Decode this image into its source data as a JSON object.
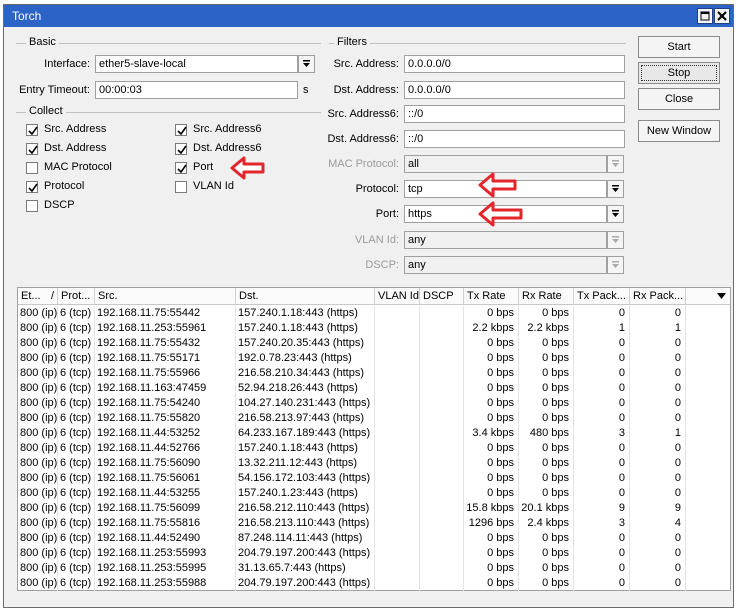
{
  "window": {
    "title": "Torch"
  },
  "basic": {
    "label": "Basic",
    "interface_label": "Interface:",
    "interface_value": "ether5-slave-local",
    "timeout_label": "Entry Timeout:",
    "timeout_value": "00:00:03",
    "timeout_unit": "s"
  },
  "collect": {
    "label": "Collect",
    "items": [
      {
        "label": "Src. Address",
        "checked": true
      },
      {
        "label": "Dst. Address",
        "checked": true
      },
      {
        "label": "MAC Protocol",
        "checked": false
      },
      {
        "label": "Protocol",
        "checked": true
      },
      {
        "label": "DSCP",
        "checked": false
      },
      {
        "label": "Src. Address6",
        "checked": true
      },
      {
        "label": "Dst. Address6",
        "checked": true
      },
      {
        "label": "Port",
        "checked": true
      },
      {
        "label": "VLAN Id",
        "checked": false
      }
    ]
  },
  "filters": {
    "label": "Filters",
    "src_address_label": "Src. Address:",
    "src_address_value": "0.0.0.0/0",
    "dst_address_label": "Dst. Address:",
    "dst_address_value": "0.0.0.0/0",
    "src_address6_label": "Src. Address6:",
    "src_address6_value": "::/0",
    "dst_address6_label": "Dst. Address6:",
    "dst_address6_value": "::/0",
    "mac_protocol_label": "MAC Protocol:",
    "mac_protocol_value": "all",
    "protocol_label": "Protocol:",
    "protocol_value": "tcp",
    "port_label": "Port:",
    "port_value": "https",
    "vlan_label": "VLAN Id:",
    "vlan_value": "any",
    "dscp_label": "DSCP:",
    "dscp_value": "any"
  },
  "buttons": {
    "start": "Start",
    "stop": "Stop",
    "close": "Close",
    "new_window": "New Window"
  },
  "table": {
    "columns": [
      "Et...",
      "Prot...",
      "Src.",
      "Dst.",
      "VLAN Id",
      "DSCP",
      "Tx Rate",
      "Rx Rate",
      "Tx Pack...",
      "Rx Pack..."
    ],
    "sort_indicator": "/",
    "rows": [
      [
        "800 (ip)",
        "6 (tcp)",
        "192.168.11.75:55442",
        "157.240.1.18:443 (https)",
        "",
        "",
        "0 bps",
        "0 bps",
        "0",
        "0"
      ],
      [
        "800 (ip)",
        "6 (tcp)",
        "192.168.11.253:55961",
        "157.240.1.18:443 (https)",
        "",
        "",
        "2.2 kbps",
        "2.2 kbps",
        "1",
        "1"
      ],
      [
        "800 (ip)",
        "6 (tcp)",
        "192.168.11.75:55432",
        "157.240.20.35:443 (https)",
        "",
        "",
        "0 bps",
        "0 bps",
        "0",
        "0"
      ],
      [
        "800 (ip)",
        "6 (tcp)",
        "192.168.11.75:55171",
        "192.0.78.23:443 (https)",
        "",
        "",
        "0 bps",
        "0 bps",
        "0",
        "0"
      ],
      [
        "800 (ip)",
        "6 (tcp)",
        "192.168.11.75:55966",
        "216.58.210.34:443 (https)",
        "",
        "",
        "0 bps",
        "0 bps",
        "0",
        "0"
      ],
      [
        "800 (ip)",
        "6 (tcp)",
        "192.168.11.163:47459",
        "52.94.218.26:443 (https)",
        "",
        "",
        "0 bps",
        "0 bps",
        "0",
        "0"
      ],
      [
        "800 (ip)",
        "6 (tcp)",
        "192.168.11.75:54240",
        "104.27.140.231:443 (https)",
        "",
        "",
        "0 bps",
        "0 bps",
        "0",
        "0"
      ],
      [
        "800 (ip)",
        "6 (tcp)",
        "192.168.11.75:55820",
        "216.58.213.97:443 (https)",
        "",
        "",
        "0 bps",
        "0 bps",
        "0",
        "0"
      ],
      [
        "800 (ip)",
        "6 (tcp)",
        "192.168.11.44:53252",
        "64.233.167.189:443 (https)",
        "",
        "",
        "3.4 kbps",
        "480 bps",
        "3",
        "1"
      ],
      [
        "800 (ip)",
        "6 (tcp)",
        "192.168.11.44:52766",
        "157.240.1.18:443 (https)",
        "",
        "",
        "0 bps",
        "0 bps",
        "0",
        "0"
      ],
      [
        "800 (ip)",
        "6 (tcp)",
        "192.168.11.75:56090",
        "13.32.211.12:443 (https)",
        "",
        "",
        "0 bps",
        "0 bps",
        "0",
        "0"
      ],
      [
        "800 (ip)",
        "6 (tcp)",
        "192.168.11.75:56061",
        "54.156.172.103:443 (https)",
        "",
        "",
        "0 bps",
        "0 bps",
        "0",
        "0"
      ],
      [
        "800 (ip)",
        "6 (tcp)",
        "192.168.11.44:53255",
        "157.240.1.23:443 (https)",
        "",
        "",
        "0 bps",
        "0 bps",
        "0",
        "0"
      ],
      [
        "800 (ip)",
        "6 (tcp)",
        "192.168.11.75:56099",
        "216.58.212.110:443 (https)",
        "",
        "",
        "15.8 kbps",
        "20.1 kbps",
        "9",
        "9"
      ],
      [
        "800 (ip)",
        "6 (tcp)",
        "192.168.11.75:55816",
        "216.58.213.110:443 (https)",
        "",
        "",
        "1296 bps",
        "2.4 kbps",
        "3",
        "4"
      ],
      [
        "800 (ip)",
        "6 (tcp)",
        "192.168.11.44:52490",
        "87.248.114.11:443 (https)",
        "",
        "",
        "0 bps",
        "0 bps",
        "0",
        "0"
      ],
      [
        "800 (ip)",
        "6 (tcp)",
        "192.168.11.253:55993",
        "204.79.197.200:443 (https)",
        "",
        "",
        "0 bps",
        "0 bps",
        "0",
        "0"
      ],
      [
        "800 (ip)",
        "6 (tcp)",
        "192.168.11.253:55995",
        "31.13.65.7:443 (https)",
        "",
        "",
        "0 bps",
        "0 bps",
        "0",
        "0"
      ],
      [
        "800 (ip)",
        "6 (tcp)",
        "192.168.11.253:55988",
        "204.79.197.200:443 (https)",
        "",
        "",
        "0 bps",
        "0 bps",
        "0",
        "0"
      ]
    ]
  },
  "icons": {
    "checkbox": "check-icon",
    "dropdown": "chevron-down-icon",
    "annotation": "red-arrow-icon",
    "annotation_color": "#e3262b"
  }
}
